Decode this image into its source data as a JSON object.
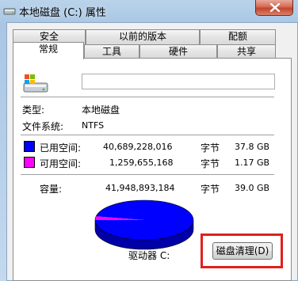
{
  "window": {
    "title": "本地磁盘 (C:) 属性"
  },
  "tabs": {
    "row1": [
      "安全",
      "以前的版本",
      "配额"
    ],
    "row2": [
      "常规",
      "工具",
      "硬件",
      "共享"
    ],
    "active": "常规"
  },
  "general": {
    "volume_name_value": "",
    "type_label": "类型:",
    "type_value": "本地磁盘",
    "fs_label": "文件系统:",
    "fs_value": "NTFS",
    "used": {
      "label": "已用空间:",
      "bytes": "40,689,228,016",
      "unit": "字节",
      "size": "37.8 GB",
      "color": "#0000ff"
    },
    "free": {
      "label": "可用空间:",
      "bytes": "1,259,655,168",
      "unit": "字节",
      "size": "1.17 GB",
      "color": "#ff00ff"
    },
    "capacity": {
      "label": "容量:",
      "bytes": "41,948,893,184",
      "unit": "字节",
      "size": "39.0 GB"
    },
    "drive_label": "驱动器 C:",
    "cleanup_button": "磁盘清理(D)"
  },
  "chart_data": {
    "type": "pie",
    "categories": [
      "已用空间",
      "可用空间"
    ],
    "values": [
      40689228016,
      1259655168
    ],
    "colors": [
      "#0000ff",
      "#ff00ff"
    ]
  }
}
